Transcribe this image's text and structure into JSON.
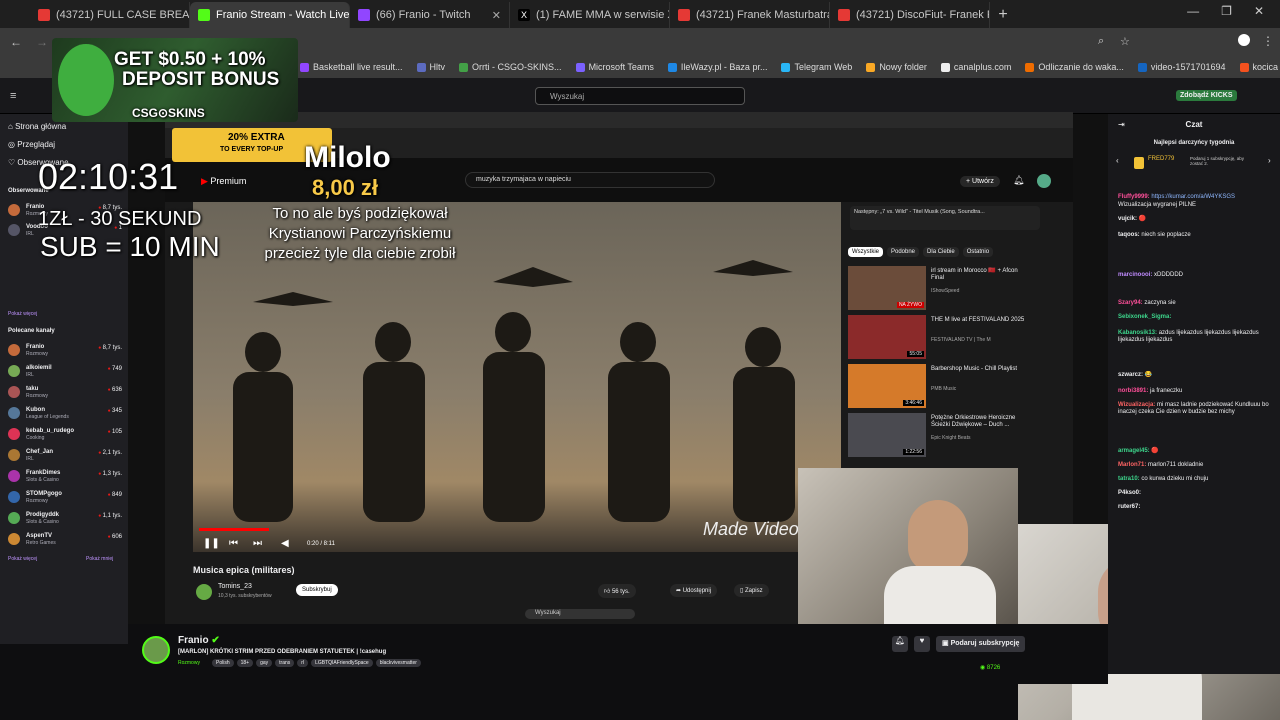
{
  "browser": {
    "tabs": [
      {
        "label": "(43721) FULL CASE BREAK UCC",
        "color": "#e53935"
      },
      {
        "label": "Franio Stream - Watch Live",
        "color": "#53fc18"
      },
      {
        "label": "(66) Franio - Twitch",
        "color": "#9146ff"
      },
      {
        "label": "(1) FAME MMA w serwisie X: „B",
        "color": "#000000"
      },
      {
        "label": "(43721) Franek Masturbatra - D",
        "color": "#e53935"
      },
      {
        "label": "(43721) DiscoFiut- Franek Praw",
        "color": "#e53935"
      }
    ],
    "new_tab": "+",
    "bookmarks": [
      "Basketball live result...",
      "Hltv",
      "Orrti - CSGO-SKINS...",
      "Microsoft Teams",
      "IleWazy.pl - Baza pr...",
      "Telegram Web",
      "Nowy folder",
      "canalplus.com",
      "Odliczanie do waka...",
      "video-1571701694",
      "kocica"
    ],
    "bookmark_colors": [
      "#9146ff",
      "#5c6bc0",
      "#43a047",
      "#7b61ff",
      "#1e88e5",
      "#29b6f6",
      "#f9a825",
      "#eeeeee",
      "#ef6c00",
      "#1565c0",
      "#f4511e"
    ]
  },
  "twitch": {
    "search_placeholder": "Wyszukaj",
    "kicks": "Zdobądź KICKS",
    "nav": [
      "Strona główna",
      "Przeglądaj",
      "Obserwowane"
    ],
    "followed_header": "Obserwowane",
    "show_more": "Pokaż więcej",
    "show_less": "Pokaż mniej",
    "followed": [
      {
        "name": "Franio",
        "game": "Rozmowy",
        "viewers": "8,7 tys."
      },
      {
        "name": "Voodoo",
        "game": "IRL",
        "viewers": "1"
      }
    ],
    "recommended_header": "Polecane kanały",
    "recommended": [
      {
        "name": "Franio",
        "game": "Rozmowy",
        "viewers": "8,7 tys."
      },
      {
        "name": "alkoiemil",
        "game": "IRL",
        "viewers": "749"
      },
      {
        "name": "taku",
        "game": "Rozmowy",
        "viewers": "636"
      },
      {
        "name": "Kubon",
        "game": "League of Legends",
        "viewers": "345"
      },
      {
        "name": "kebab_u_rudego",
        "game": "Cooking",
        "viewers": "105"
      },
      {
        "name": "Chef_Jan",
        "game": "IRL",
        "viewers": "2,1 tys."
      },
      {
        "name": "FrankDimes",
        "game": "Slots & Casino",
        "viewers": "1,3 tys."
      },
      {
        "name": "STOMPgogo",
        "game": "Rozmowy",
        "viewers": "849"
      },
      {
        "name": "Prodigyddk",
        "game": "Slots & Casino",
        "viewers": "1,1 tys."
      },
      {
        "name": "AspenTV",
        "game": "Retro Games",
        "viewers": "606"
      }
    ]
  },
  "overlay": {
    "ad_line1": "GET $0.50 + 10%",
    "ad_line2": "DEPOSIT BONUS",
    "ad_brand": "CSG⊙SKINS",
    "timer": "02:10:31",
    "rate1": "1ZŁ - 30 SEKUND",
    "rate2": "SUB = 10 MIN",
    "promo": "20% EXTRA",
    "promo2": "TO EVERY TOP-UP",
    "donor": "Milolo",
    "amount": "8,00 zł",
    "donation_msg": "To no ale byś podziękował Krystianowi Parczyńskiemu przecież tyle dla ciebie zrobił"
  },
  "youtube": {
    "logo": "Premium",
    "search": "muzyka trzymajaca w napieciu",
    "create": "Utwórz",
    "title": "Musica epica (militares)",
    "channel": "Tomins_23",
    "subs": "10,3 tys. subskrybentów",
    "subscribe": "Subskrybuj",
    "time": "0:20 / 8:11",
    "likes": "56 tys.",
    "share": "Udostępnij",
    "save": "Zapisz",
    "watermark": "Made Video Sh",
    "next": "Następny: „7 vs. Wild” - Titel Musik (Song, Soundtra...",
    "chips": [
      "Wszystkie",
      "Podobne",
      "Dla Ciebie",
      "Ostatnio"
    ],
    "related": [
      {
        "title": "irl stream in Morocco 🇲🇦 + Afcon Final",
        "meta": "IShowSpeed",
        "badge": "NA ŻYWO"
      },
      {
        "title": "THE M live at FESTIVALAND 2025",
        "meta": "FESTIVALAND TV | The M",
        "badge": "55:05"
      },
      {
        "title": "Barbershop Music - Chill Playlist",
        "meta": "PMB Music",
        "badge": "3:46:46"
      },
      {
        "title": "Potężne Orkiestrowe Heroiczne Ścieżki Dźwiękowe – Duch ...",
        "meta": "Epic Knight Beats",
        "badge": "1:22:56"
      }
    ],
    "taskbar_search": "Wyszukaj"
  },
  "stream": {
    "streamer": "Franio",
    "title": "[MARLON] KRÓTKI STRIM PRZED ODEBRANIEM STATUETEK | !casehug",
    "category": "Rozmowy",
    "tags": [
      "Polish",
      "18+",
      "gay",
      "trans",
      "rl",
      "LGBTQIAFriendlySpace",
      "blackvivesmatter"
    ],
    "sub_button": "Podaruj subskrypcję",
    "viewers": "8726"
  },
  "chat": {
    "header": "Czat",
    "gift_title": "Najlepsi darczyńcy tygodnia",
    "gifter": "FRED779",
    "gifter_note": "Podaruj 1 subskrypcję, aby zostać 2.",
    "messages": [
      {
        "user": "Fluffy9999:",
        "text": "https://kumar.com/a/W4YKSGS",
        "color": "#ff4f9a"
      },
      {
        "user": "",
        "text": "Wizualizacja wygranej PILNE",
        "color": "#ffffff"
      },
      {
        "user": "vujcik:",
        "text": "🔴",
        "color": "#ffffff"
      },
      {
        "user": "taqoos:",
        "text": "niech sie poplacze",
        "color": "#ffffff"
      },
      {
        "user": "marcinoooi:",
        "text": "xDDDDDD",
        "color": "#c08bff"
      },
      {
        "user": "Szary94:",
        "text": "zaczyna sie",
        "color": "#ff4f9a"
      },
      {
        "user": "Sebixonek_Sigma:",
        "text": "",
        "color": "#3dd68c"
      },
      {
        "user": "Kabanosik13:",
        "text": "azdus lijekazdus lijekazdus lijekazdus lijekazdus lijekazdus",
        "color": "#3dd68c"
      },
      {
        "user": "szwarcz:",
        "text": "😂",
        "color": "#ffffff"
      },
      {
        "user": "norbi3891:",
        "text": "ja franeczku",
        "color": "#ff4f9a"
      },
      {
        "user": "Wizualizacja:",
        "text": "mi masz ladnie podziekować Kundluuu bo inaczej czeka Cie dzien w budzie bez michy",
        "color": "#ff6464"
      },
      {
        "user": "armagel45:",
        "text": "🔴",
        "color": "#3dd68c"
      },
      {
        "user": "Marlon71:",
        "text": "marlon711 dokladnie",
        "color": "#ff6464"
      },
      {
        "user": "tatra10:",
        "text": "co kurwa dzieku mi chuju",
        "color": "#3dd68c"
      },
      {
        "user": "P4kso0:",
        "text": "",
        "color": "#ffffff"
      },
      {
        "user": "ruter67:",
        "text": "",
        "color": "#ffffff"
      }
    ]
  }
}
